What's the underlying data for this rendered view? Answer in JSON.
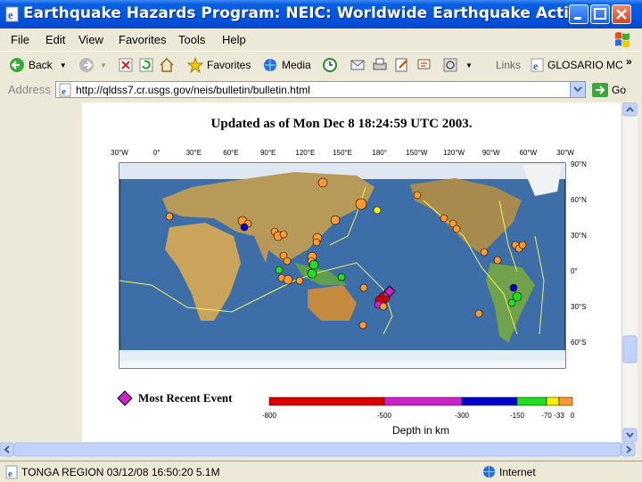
{
  "window": {
    "title": "Earthquake Hazards Program: NEIC: Worldwide Earthquake Acti..."
  },
  "menu": [
    "File",
    "Edit",
    "View",
    "Favorites",
    "Tools",
    "Help"
  ],
  "toolbar": {
    "back": "Back",
    "favorites": "Favorites",
    "media": "Media",
    "links": "Links",
    "glosario": "GLOSARIO MC",
    "more": "»"
  },
  "address": {
    "label": "Address",
    "url": "http://qldss7.cr.usgs.gov/neis/bulletin/bulletin.html",
    "go": "Go"
  },
  "page": {
    "updated": "Updated as of Mon Dec 8 18:24:59 UTC 2003.",
    "lon_labels": [
      "30°W",
      "0°",
      "30°E",
      "60°E",
      "90°E",
      "120°E",
      "150°E",
      "180°",
      "150°W",
      "120°W",
      "90°W",
      "60°W",
      "30°W"
    ],
    "lat_labels": [
      "90°N",
      "60°N",
      "30°N",
      "0°",
      "30°S",
      "60°S"
    ],
    "legend_label": "Most Recent Event",
    "depth_ticks": [
      "-800",
      "-500",
      "-300",
      "-150",
      "-70",
      "-33",
      "0"
    ],
    "depth_title": "Depth in km",
    "colors": {
      "depth_800_500": "#dd0000",
      "depth_500_300": "#cc22cc",
      "depth_300_150": "#0000cc",
      "depth_150_70": "#22dd22",
      "depth_70_33": "#ffee00",
      "depth_33_0": "#ff9933",
      "recent": "#cc22cc"
    }
  },
  "status": {
    "text": "TONGA REGION 03/12/08 16:50:20 5.1M",
    "zone": "Internet"
  }
}
